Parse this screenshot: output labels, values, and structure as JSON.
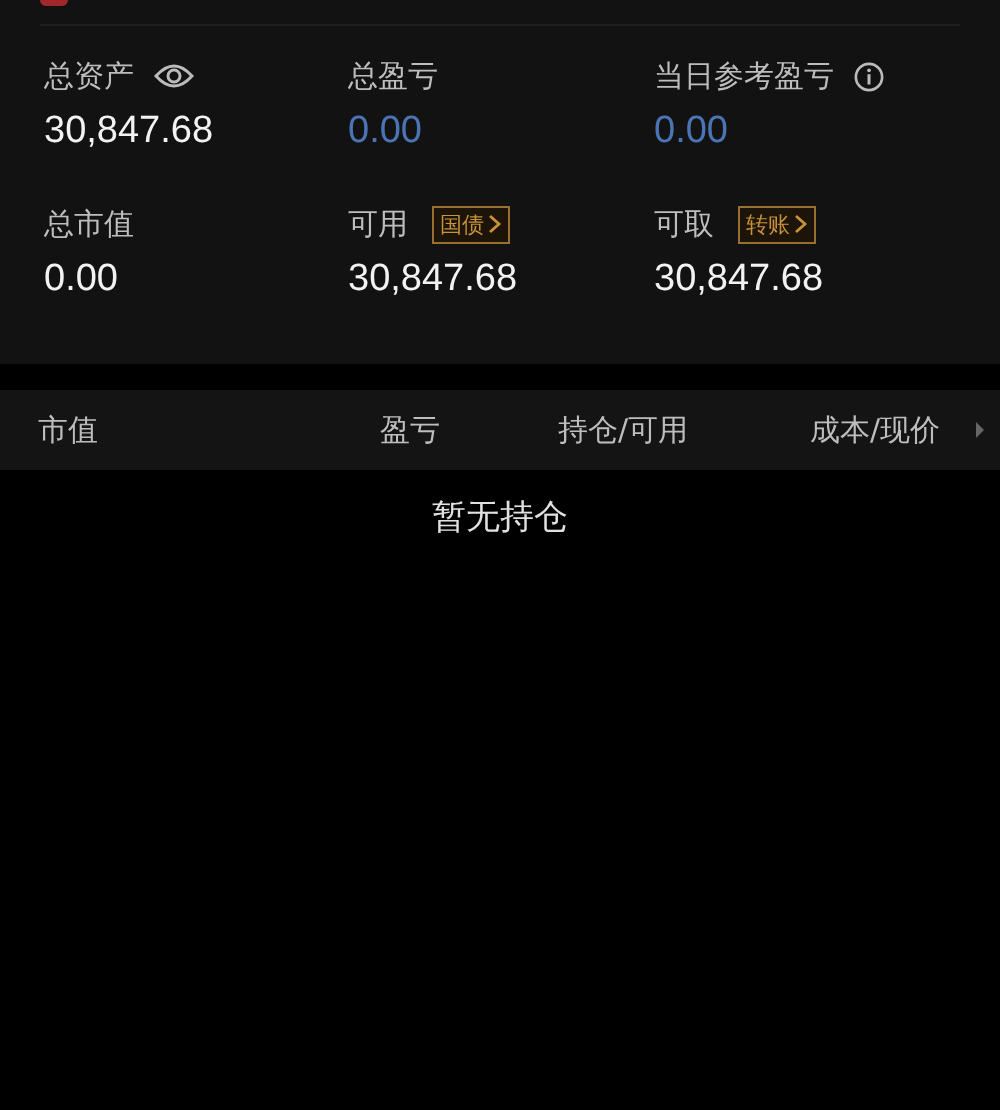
{
  "summary": [
    {
      "kind": "eye",
      "label": "总资产",
      "value": "30,847.68",
      "color": "#f2f2f2"
    },
    {
      "kind": "plain",
      "label": "总盈亏",
      "value": "0.00",
      "color": "#4a74b4"
    },
    {
      "kind": "info",
      "label": "当日参考盈亏",
      "value": "0.00",
      "color": "#4a74b4"
    },
    {
      "kind": "plain",
      "label": "总市值",
      "value": "0.00",
      "color": "#f2f2f2"
    },
    {
      "kind": "tag",
      "label": "可用",
      "tag": "国债",
      "value": "30,847.68",
      "color": "#f2f2f2"
    },
    {
      "kind": "tag",
      "label": "可取",
      "tag": "转账",
      "value": "30,847.68",
      "color": "#f2f2f2"
    }
  ],
  "table": {
    "columns": [
      "市值",
      "盈亏",
      "持仓/可用",
      "成本/现价"
    ],
    "empty_message": "暂无持仓"
  }
}
